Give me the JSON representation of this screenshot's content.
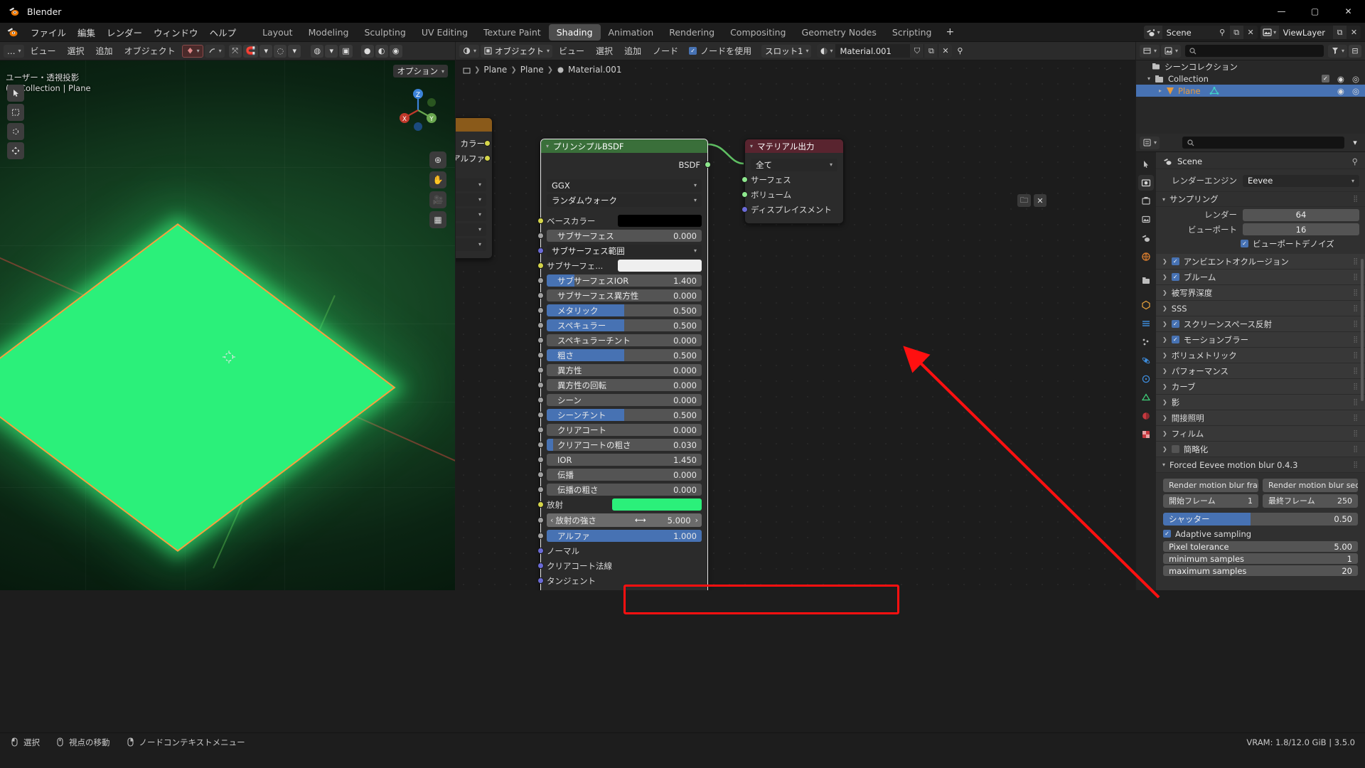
{
  "window": {
    "title": "Blender",
    "minimize": "—",
    "maximize": "▢",
    "close": "✕"
  },
  "topbar": {
    "menus": [
      "ファイル",
      "編集",
      "レンダー",
      "ウィンドウ",
      "ヘルプ"
    ],
    "workspaces": [
      "Layout",
      "Modeling",
      "Sculpting",
      "UV Editing",
      "Texture Paint",
      "Shading",
      "Animation",
      "Rendering",
      "Compositing",
      "Geometry Nodes",
      "Scripting"
    ],
    "active_workspace": "Shading",
    "add_workspace": "+",
    "scene_name": "Scene",
    "viewlayer_name": "ViewLayer",
    "new_icon": "⧉",
    "close_icon": "✕",
    "pin_icon": "⚲"
  },
  "viewport": {
    "header": {
      "editor_type": "…",
      "menus": [
        "ビュー",
        "選択",
        "追加",
        "オブジェクト"
      ],
      "options_label": "オプション"
    },
    "overlay_line1": "ユーザー・透視投影",
    "overlay_line2": "(1) Collection | Plane",
    "gizmo_axes": [
      "X",
      "Y",
      "Z"
    ],
    "object_color": "#2bf07a",
    "outline_color": "#ff9b3d"
  },
  "shader": {
    "header": {
      "shader_type": "オブジェクト",
      "menus": [
        "ビュー",
        "選択",
        "追加",
        "ノード"
      ],
      "use_nodes_label": "ノードを使用",
      "use_nodes_checked": true,
      "slot_label": "スロット1",
      "material_name": "Material.001",
      "shield_icon": "⛉",
      "copy_icon": "⧉",
      "close_icon": "✕",
      "pin_icon": "⚲"
    },
    "breadcrumb": [
      "Plane",
      "Plane",
      "Material.001"
    ],
    "nodes": [
      {
        "name": "principled-bsdf",
        "title": "プリンシプルBSDF",
        "header_color": "#3a6f3a",
        "outputs": [
          {
            "label": "BSDF",
            "color": "#8ee88e"
          }
        ],
        "dropdowns": [
          "GGX",
          "ランダムウォーク"
        ],
        "inputs": [
          {
            "label": "ベースカラー",
            "type": "color",
            "color": "#000000",
            "socket": "#d6d64a"
          },
          {
            "label": "サブサーフェス",
            "type": "slider",
            "value": "0.000",
            "fill": 0,
            "socket": "#a1a1a1"
          },
          {
            "label": "サブサーフェス範囲",
            "type": "dropdown",
            "socket": "#6b6bd8"
          },
          {
            "label": "サブサーフェ...",
            "type": "color",
            "color": "#efefef",
            "socket": "#d6d64a"
          },
          {
            "label": "サブサーフェスIOR",
            "type": "slider",
            "value": "1.400",
            "fill": 18,
            "socket": "#a1a1a1"
          },
          {
            "label": "サブサーフェス異方性",
            "type": "slider",
            "value": "0.000",
            "fill": 0,
            "socket": "#a1a1a1"
          },
          {
            "label": "メタリック",
            "type": "slider",
            "value": "0.500",
            "fill": 50,
            "socket": "#a1a1a1"
          },
          {
            "label": "スペキュラー",
            "type": "slider",
            "value": "0.500",
            "fill": 50,
            "socket": "#a1a1a1"
          },
          {
            "label": "スペキュラーチント",
            "type": "slider",
            "value": "0.000",
            "fill": 0,
            "socket": "#a1a1a1"
          },
          {
            "label": "粗さ",
            "type": "slider",
            "value": "0.500",
            "fill": 50,
            "socket": "#a1a1a1"
          },
          {
            "label": "異方性",
            "type": "slider",
            "value": "0.000",
            "fill": 0,
            "socket": "#a1a1a1"
          },
          {
            "label": "異方性の回転",
            "type": "slider",
            "value": "0.000",
            "fill": 0,
            "socket": "#a1a1a1"
          },
          {
            "label": "シーン",
            "type": "slider",
            "value": "0.000",
            "fill": 0,
            "socket": "#a1a1a1"
          },
          {
            "label": "シーンチント",
            "type": "slider",
            "value": "0.500",
            "fill": 50,
            "socket": "#a1a1a1"
          },
          {
            "label": "クリアコート",
            "type": "slider",
            "value": "0.000",
            "fill": 0,
            "socket": "#a1a1a1"
          },
          {
            "label": "クリアコートの粗さ",
            "type": "slider",
            "value": "0.030",
            "fill": 4,
            "socket": "#a1a1a1"
          },
          {
            "label": "IOR",
            "type": "slider",
            "value": "1.450",
            "fill": 0,
            "socket": "#a1a1a1"
          },
          {
            "label": "伝播",
            "type": "slider",
            "value": "0.000",
            "fill": 0,
            "socket": "#a1a1a1"
          },
          {
            "label": "伝播の粗さ",
            "type": "slider",
            "value": "0.000",
            "fill": 0,
            "socket": "#a1a1a1"
          },
          {
            "label": "放射",
            "type": "color",
            "color": "#2bf07a",
            "socket": "#d6d64a"
          },
          {
            "label": "放射の強さ",
            "type": "number_arrows",
            "value": "5.000",
            "left_arrow": "‹",
            "right_arrow": "›",
            "socket": "#a1a1a1",
            "highlighted": true
          },
          {
            "label": "アルファ",
            "type": "slider",
            "value": "1.000",
            "fill": 100,
            "socket": "#a1a1a1"
          },
          {
            "label": "ノーマル",
            "type": "plain",
            "socket": "#6b6bd8"
          },
          {
            "label": "クリアコート法線",
            "type": "plain",
            "socket": "#6b6bd8"
          },
          {
            "label": "タンジェント",
            "type": "plain",
            "socket": "#6b6bd8"
          }
        ]
      },
      {
        "name": "material-output",
        "title": "マテリアル出力",
        "header_color": "#59242f",
        "dropdowns": [
          "全て"
        ],
        "inputs": [
          {
            "label": "サーフェス",
            "type": "plain",
            "socket": "#8ee88e"
          },
          {
            "label": "ボリューム",
            "type": "plain",
            "socket": "#8ee88e"
          },
          {
            "label": "ディスプレイスメント",
            "type": "plain",
            "socket": "#6b6bd8"
          }
        ]
      }
    ],
    "partial_node": {
      "labels": [
        "カラー",
        "アルファ"
      ],
      "socket_colors": [
        "#d6d64a",
        "#d6d64a"
      ]
    }
  },
  "outliner": {
    "header": {
      "display_mode_icon": "⛁",
      "filter_icon": "⛃",
      "search_placeholder": ""
    },
    "rows": [
      {
        "label": "シーンコレクション",
        "indent": 0,
        "icon": "collection",
        "selected": false,
        "expand": ""
      },
      {
        "label": "Collection",
        "indent": 1,
        "icon": "collection",
        "selected": false,
        "expand": "▾",
        "checkbox": true,
        "eye": "◉",
        "camera": "◎"
      },
      {
        "label": "Plane",
        "indent": 2,
        "icon": "mesh",
        "selected": true,
        "expand": "▸",
        "eye": "◉",
        "camera": "◎"
      }
    ]
  },
  "properties": {
    "search_placeholder": "",
    "id_name": "Scene",
    "pin_icon": "⚲",
    "render_engine_label": "レンダーエンジン",
    "render_engine_value": "Eevee",
    "sampling": {
      "title": "サンプリング",
      "rows": [
        {
          "label": "レンダー",
          "value": "64"
        },
        {
          "label": "ビューポート",
          "value": "16"
        }
      ],
      "denoise_label": "ビューポートデノイズ",
      "denoise_checked": true
    },
    "panels": [
      {
        "label": "アンビエントオクルージョン",
        "checkbox": true,
        "checked": true
      },
      {
        "label": "ブルーム",
        "checkbox": true,
        "checked": true
      },
      {
        "label": "被写界深度",
        "checkbox": false
      },
      {
        "label": "SSS",
        "checkbox": false
      },
      {
        "label": "スクリーンスペース反射",
        "checkbox": true,
        "checked": true
      },
      {
        "label": "モーションブラー",
        "checkbox": true,
        "checked": true
      },
      {
        "label": "ボリュメトリック",
        "checkbox": false
      },
      {
        "label": "パフォーマンス",
        "checkbox": false
      },
      {
        "label": "カーブ",
        "checkbox": false
      },
      {
        "label": "影",
        "checkbox": false
      },
      {
        "label": "間接照明",
        "checkbox": false
      },
      {
        "label": "フィルム",
        "checkbox": false
      },
      {
        "label": "簡略化",
        "checkbox": true,
        "checked": false
      }
    ],
    "addon": {
      "title": "Forced Eevee motion blur 0.4.3",
      "buttons": [
        "Render motion blur frame",
        "Render motion blur seq..."
      ],
      "frame_row": [
        {
          "label": "開始フレーム",
          "value": "1"
        },
        {
          "label": "最終フレーム",
          "value": "250"
        }
      ],
      "shutter": {
        "label": "シャッター",
        "value": "0.50",
        "fill": 45
      },
      "adaptive_label": "Adaptive sampling",
      "adaptive_checked": true,
      "adaptive_rows": [
        {
          "label": "Pixel tolerance",
          "value": "5.00"
        },
        {
          "label": "minimum samples",
          "value": "1"
        },
        {
          "label": "maximum samples",
          "value": "20"
        }
      ]
    }
  },
  "status": {
    "items": [
      "選択",
      "視点の移動",
      "ノードコンテキストメニュー"
    ],
    "right": "VRAM: 1.8/12.0 GiB | 3.5.0"
  },
  "annotation": {
    "color": "#ff1010"
  }
}
